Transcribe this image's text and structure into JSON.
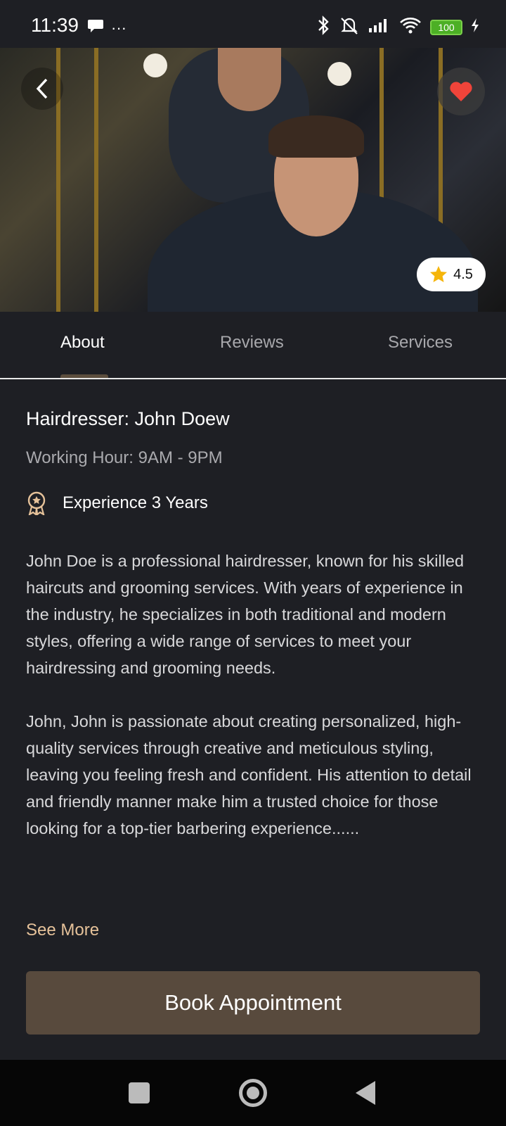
{
  "status_bar": {
    "time": "11:39",
    "more": "···",
    "battery": "100"
  },
  "hero": {
    "rating": "4.5"
  },
  "tabs": [
    {
      "label": "About"
    },
    {
      "label": "Reviews"
    },
    {
      "label": "Services"
    }
  ],
  "profile": {
    "title": "Hairdresser: John Doew",
    "working_hours": "Working Hour: 9AM - 9PM",
    "experience": "Experience 3 Years",
    "description": [
      "John Doe is a professional hairdresser, known for his skilled haircuts and grooming services. With years of experience in the industry, he specializes in both traditional and modern styles, offering a wide range of services to meet your hairdressing and grooming needs.",
      "John, John is passionate about creating personalized, high-quality services through creative and meticulous styling, leaving you feeling fresh and confident. His attention to detail and friendly manner make him a trusted choice for those looking for a top-tier barbering experience......"
    ],
    "see_more": "See More"
  },
  "actions": {
    "book": "Book Appointment"
  },
  "colors": {
    "background": "#1e1f24",
    "accent_text": "#e6c29a",
    "button": "#584a3d",
    "heart": "#f0443a",
    "star": "#f5b50a"
  }
}
